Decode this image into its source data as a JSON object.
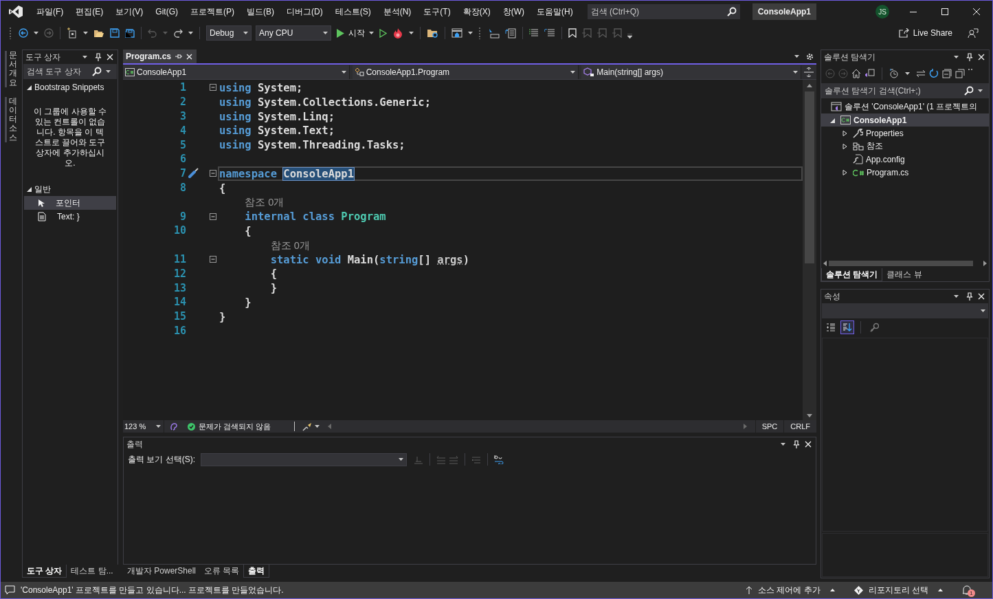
{
  "title_bar": {
    "menus": [
      "파일(F)",
      "편집(E)",
      "보기(V)",
      "Git(G)",
      "프로젝트(P)",
      "빌드(B)",
      "디버그(D)",
      "테스트(S)",
      "분석(N)",
      "도구(T)",
      "확장(X)",
      "창(W)",
      "도움말(H)"
    ],
    "search": {
      "placeholder": "검색 (Ctrl+Q)"
    },
    "solution_name": "ConsoleApp1",
    "avatar": "JS"
  },
  "toolbar": {
    "configuration": "Debug",
    "platform": "Any CPU",
    "start": "시작",
    "live_share": "Live Share"
  },
  "side_tabs": [
    "문서 개요",
    "데이터 소스"
  ],
  "toolbox": {
    "title": "도구 상자",
    "search": {
      "placeholder": "검색 도구 상자"
    },
    "groups": [
      {
        "label": "Bootstrap Snippets",
        "expanded": true,
        "message": "이 그룹에 사용할 수 있는 컨트롤이 없습니다. 항목을 이 텍스트로 끌어와 도구 상자에 추가하십시오."
      },
      {
        "label": "일반",
        "expanded": true,
        "items": [
          {
            "label": "포인터",
            "kind": "pointer",
            "selected": true
          },
          {
            "label": "Text: }",
            "kind": "text",
            "selected": false
          }
        ]
      }
    ],
    "tabs": [
      {
        "label": "도구 상자",
        "selected": true
      },
      {
        "label": "테스트 탐...",
        "selected": false
      }
    ]
  },
  "editor": {
    "tabs": [
      {
        "label": "Program.cs",
        "selected": true
      }
    ],
    "nav": [
      "ConsoleApp1",
      "ConsoleApp1.Program",
      "Main(string[] args)"
    ],
    "lines": [
      {
        "kind": "code",
        "number": "1",
        "current": false,
        "collapsible": true,
        "tokens": [
          {
            "text": "using",
            "kind": "keyword"
          },
          {
            "text": " System;",
            "kind": "plain"
          }
        ]
      },
      {
        "kind": "code",
        "number": "2",
        "current": false,
        "collapsible": false,
        "tokens": [
          {
            "text": "using",
            "kind": "keyword"
          },
          {
            "text": " System.Collections.Generic;",
            "kind": "plain"
          }
        ]
      },
      {
        "kind": "code",
        "number": "3",
        "current": false,
        "collapsible": false,
        "tokens": [
          {
            "text": "using",
            "kind": "keyword"
          },
          {
            "text": " System.Linq;",
            "kind": "plain"
          }
        ]
      },
      {
        "kind": "code",
        "number": "4",
        "current": false,
        "collapsible": false,
        "tokens": [
          {
            "text": "using",
            "kind": "keyword"
          },
          {
            "text": " System.Text;",
            "kind": "plain"
          }
        ]
      },
      {
        "kind": "code",
        "number": "5",
        "current": false,
        "collapsible": false,
        "tokens": [
          {
            "text": "using",
            "kind": "keyword"
          },
          {
            "text": " System.Threading.Tasks;",
            "kind": "plain"
          }
        ]
      },
      {
        "kind": "code",
        "number": "6",
        "current": false,
        "collapsible": false
      },
      {
        "kind": "code",
        "number": "7",
        "current": true,
        "collapsible": true,
        "tokens": [
          {
            "text": "namespace ",
            "kind": "keyword"
          },
          {
            "text": "ConsoleApp1",
            "kind": "match"
          }
        ]
      },
      {
        "kind": "code",
        "number": "8",
        "current": false,
        "collapsible": false,
        "tokens": [
          {
            "text": "{",
            "kind": "plain"
          }
        ]
      },
      {
        "kind": "codelens",
        "text": "    참조 0개"
      },
      {
        "kind": "code",
        "number": "9",
        "current": false,
        "collapsible": true,
        "tokens": [
          {
            "text": "    internal class ",
            "kind": "keyword"
          },
          {
            "text": "Program",
            "kind": "type"
          }
        ]
      },
      {
        "kind": "code",
        "number": "10",
        "current": false,
        "collapsible": false,
        "tokens": [
          {
            "text": "    {",
            "kind": "plain"
          }
        ]
      },
      {
        "kind": "codelens",
        "text": "        참조 0개"
      },
      {
        "kind": "code",
        "number": "11",
        "current": false,
        "collapsible": true,
        "tokens": [
          {
            "text": "        static void",
            "kind": "keyword"
          },
          {
            "text": " Main(",
            "kind": "plain"
          },
          {
            "text": "string",
            "kind": "keyword"
          },
          {
            "text": "[] ",
            "kind": "plain"
          },
          {
            "text": "args",
            "kind": "param"
          },
          {
            "text": ")",
            "kind": "plain"
          }
        ]
      },
      {
        "kind": "code",
        "number": "12",
        "current": false,
        "collapsible": false,
        "tokens": [
          {
            "text": "        {",
            "kind": "plain"
          }
        ]
      },
      {
        "kind": "code",
        "number": "13",
        "current": false,
        "collapsible": false,
        "tokens": [
          {
            "text": "        }",
            "kind": "plain"
          }
        ]
      },
      {
        "kind": "code",
        "number": "14",
        "current": false,
        "collapsible": false,
        "tokens": [
          {
            "text": "    }",
            "kind": "plain"
          }
        ]
      },
      {
        "kind": "code",
        "number": "15",
        "current": false,
        "collapsible": false,
        "tokens": [
          {
            "text": "}",
            "kind": "plain"
          }
        ]
      },
      {
        "kind": "code",
        "number": "16",
        "current": false,
        "collapsible": false
      }
    ],
    "zoom": "123 %",
    "issues": "문제가 검색되지 않음",
    "whitespace": "SPC",
    "line_ending": "CRLF"
  },
  "output": {
    "title": "출력",
    "source_label": "출력 보기 선택(S):",
    "tabs": [
      {
        "label": "개발자 PowerShell",
        "selected": false
      },
      {
        "label": "오류 목록",
        "selected": false
      },
      {
        "label": "출력",
        "selected": true
      }
    ]
  },
  "solution_explorer": {
    "title": "솔루션 탐색기",
    "search": {
      "placeholder": "솔루션 탐색기 검색(Ctrl+;)"
    },
    "tree": [
      {
        "label": "솔루션 'ConsoleApp1' (1 프로젝트의",
        "kind": "solution",
        "selected": false,
        "children": [
          {
            "label": "ConsoleApp1",
            "kind": "project",
            "expanded": true,
            "selected": true,
            "children": [
              {
                "label": "Properties",
                "kind": "properties",
                "expanded": false,
                "selected": false
              },
              {
                "label": "참조",
                "kind": "references",
                "expanded": false,
                "selected": false
              },
              {
                "label": "App.config",
                "kind": "config",
                "selected": false
              },
              {
                "label": "Program.cs",
                "kind": "csharp",
                "expanded": false,
                "selected": false
              }
            ]
          }
        ]
      }
    ],
    "tabs": [
      {
        "label": "솔루션 탐색기",
        "selected": true
      },
      {
        "label": "클래스 뷰",
        "selected": false
      }
    ]
  },
  "properties": {
    "title": "속성",
    "views": [
      {
        "kind": "categorized",
        "selected": false
      },
      {
        "kind": "alphabetical",
        "selected": true
      },
      {
        "kind": "pages",
        "selected": false
      }
    ]
  },
  "status_bar": {
    "message": "'ConsoleApp1' 프로젝트를 만들고 있습니다... 프로젝트를 만들었습니다.",
    "source_control": "소스 제어에 추가",
    "repository": "리포지토리 선택",
    "notifications": "1"
  }
}
